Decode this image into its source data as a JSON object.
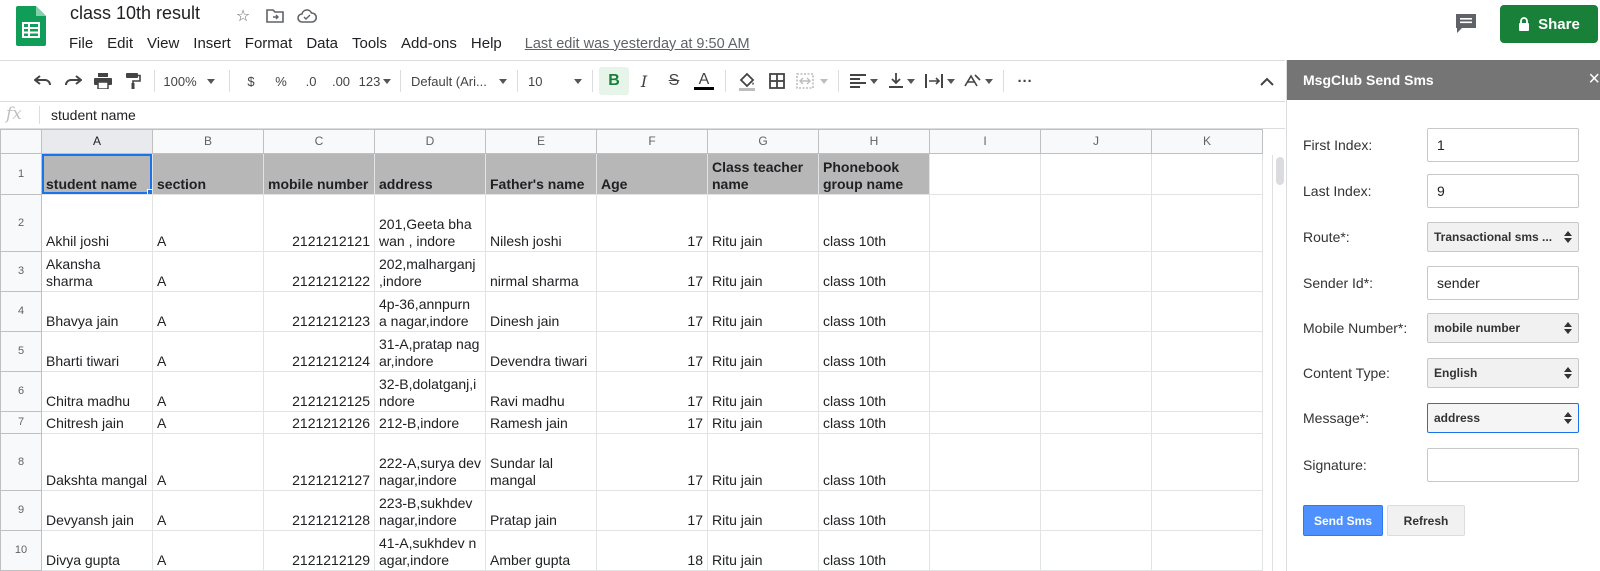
{
  "app": {
    "doc_title": "class 10th result",
    "menu": [
      "File",
      "Edit",
      "View",
      "Insert",
      "Format",
      "Data",
      "Tools",
      "Add-ons",
      "Help"
    ],
    "last_edit": "Last edit was yesterday at 9:50 AM",
    "share_label": "Share",
    "brand_green": "#188038"
  },
  "toolbar": {
    "zoom": "100%",
    "currency": "$",
    "percent": "%",
    "dec_decrease": ".0",
    "dec_increase": ".00",
    "format_more": "123",
    "font": "Default (Ari...",
    "font_size": "10",
    "bold": "B",
    "italic": "I",
    "strike": "S",
    "text_color": "A",
    "more": "···"
  },
  "formula_bar": {
    "fx": "fx",
    "value": "student name"
  },
  "sheet": {
    "columns": [
      "A",
      "B",
      "C",
      "D",
      "E",
      "F",
      "G",
      "H",
      "I",
      "J",
      "K"
    ],
    "header_row": [
      "student name",
      "section",
      "mobile number",
      "address",
      "Father's name",
      "Age",
      "Class teacher name",
      "Phonebook group name",
      "",
      "",
      ""
    ],
    "rows": [
      {
        "n": "2",
        "cells": [
          "Akhil joshi",
          "A",
          "2121212121",
          "201,Geeta bhawan , indore",
          "Nilesh joshi",
          "17",
          "Ritu jain",
          "class 10th",
          "",
          "",
          ""
        ]
      },
      {
        "n": "3",
        "cells": [
          "Akansha sharma",
          "A",
          "2121212122",
          "202,malharganj ,indore",
          "nirmal sharma",
          "17",
          "Ritu jain",
          "class 10th",
          "",
          "",
          ""
        ]
      },
      {
        "n": "4",
        "cells": [
          "Bhavya jain",
          "A",
          "2121212123",
          "4p-36,annpurn a nagar,indore",
          "Dinesh jain",
          "17",
          "Ritu jain",
          "class 10th",
          "",
          "",
          ""
        ]
      },
      {
        "n": "5",
        "cells": [
          "Bharti tiwari",
          "A",
          "2121212124",
          "31-A,pratap nagar,indore",
          "Devendra tiwari",
          "17",
          "Ritu jain",
          "class 10th",
          "",
          "",
          ""
        ]
      },
      {
        "n": "6",
        "cells": [
          "Chitra madhu",
          "A",
          "2121212125",
          "32-B,dolatganj,i ndore",
          "Ravi madhu",
          "17",
          "Ritu jain",
          "class 10th",
          "",
          "",
          ""
        ]
      },
      {
        "n": "7",
        "cells": [
          "Chitresh jain",
          "A",
          "2121212126",
          "212-B,indore",
          "Ramesh jain",
          "17",
          "Ritu jain",
          "class 10th",
          "",
          "",
          ""
        ]
      },
      {
        "n": "8",
        "cells": [
          "Dakshta mangal",
          "A",
          "2121212127",
          "222-A,surya dev nagar,indore",
          "Sundar lal mangal",
          "17",
          "Ritu jain",
          "class 10th",
          "",
          "",
          ""
        ]
      },
      {
        "n": "9",
        "cells": [
          "Devyansh jain",
          "A",
          "2121212128",
          "223-B,sukhdev nagar,indore",
          "Pratap jain",
          "17",
          "Ritu jain",
          "class 10th",
          "",
          "",
          ""
        ]
      },
      {
        "n": "10",
        "cells": [
          "Divya gupta",
          "A",
          "2121212129",
          "41-A,sukhdev nagar,indore",
          "Amber gupta",
          "18",
          "Ritu jain",
          "class 10th",
          "",
          "",
          ""
        ]
      }
    ]
  },
  "panel": {
    "title": "MsgClub Send Sms",
    "close": "×",
    "fields": {
      "first_index": {
        "label": "First Index:",
        "value": "1"
      },
      "last_index": {
        "label": "Last Index:",
        "value": "9"
      },
      "route": {
        "label": "Route*:",
        "value": "Transactional sms ..."
      },
      "sender_id": {
        "label": "Sender Id*:",
        "value": "sender"
      },
      "mobile_number": {
        "label": "Mobile Number*:",
        "value": "mobile number"
      },
      "content_type": {
        "label": "Content Type:",
        "value": "English"
      },
      "message": {
        "label": "Message*:",
        "value": "address"
      },
      "signature": {
        "label": "Signature:",
        "value": ""
      }
    },
    "send_label": "Send Sms",
    "refresh_label": "Refresh",
    "send_color": "#4d90fe"
  }
}
